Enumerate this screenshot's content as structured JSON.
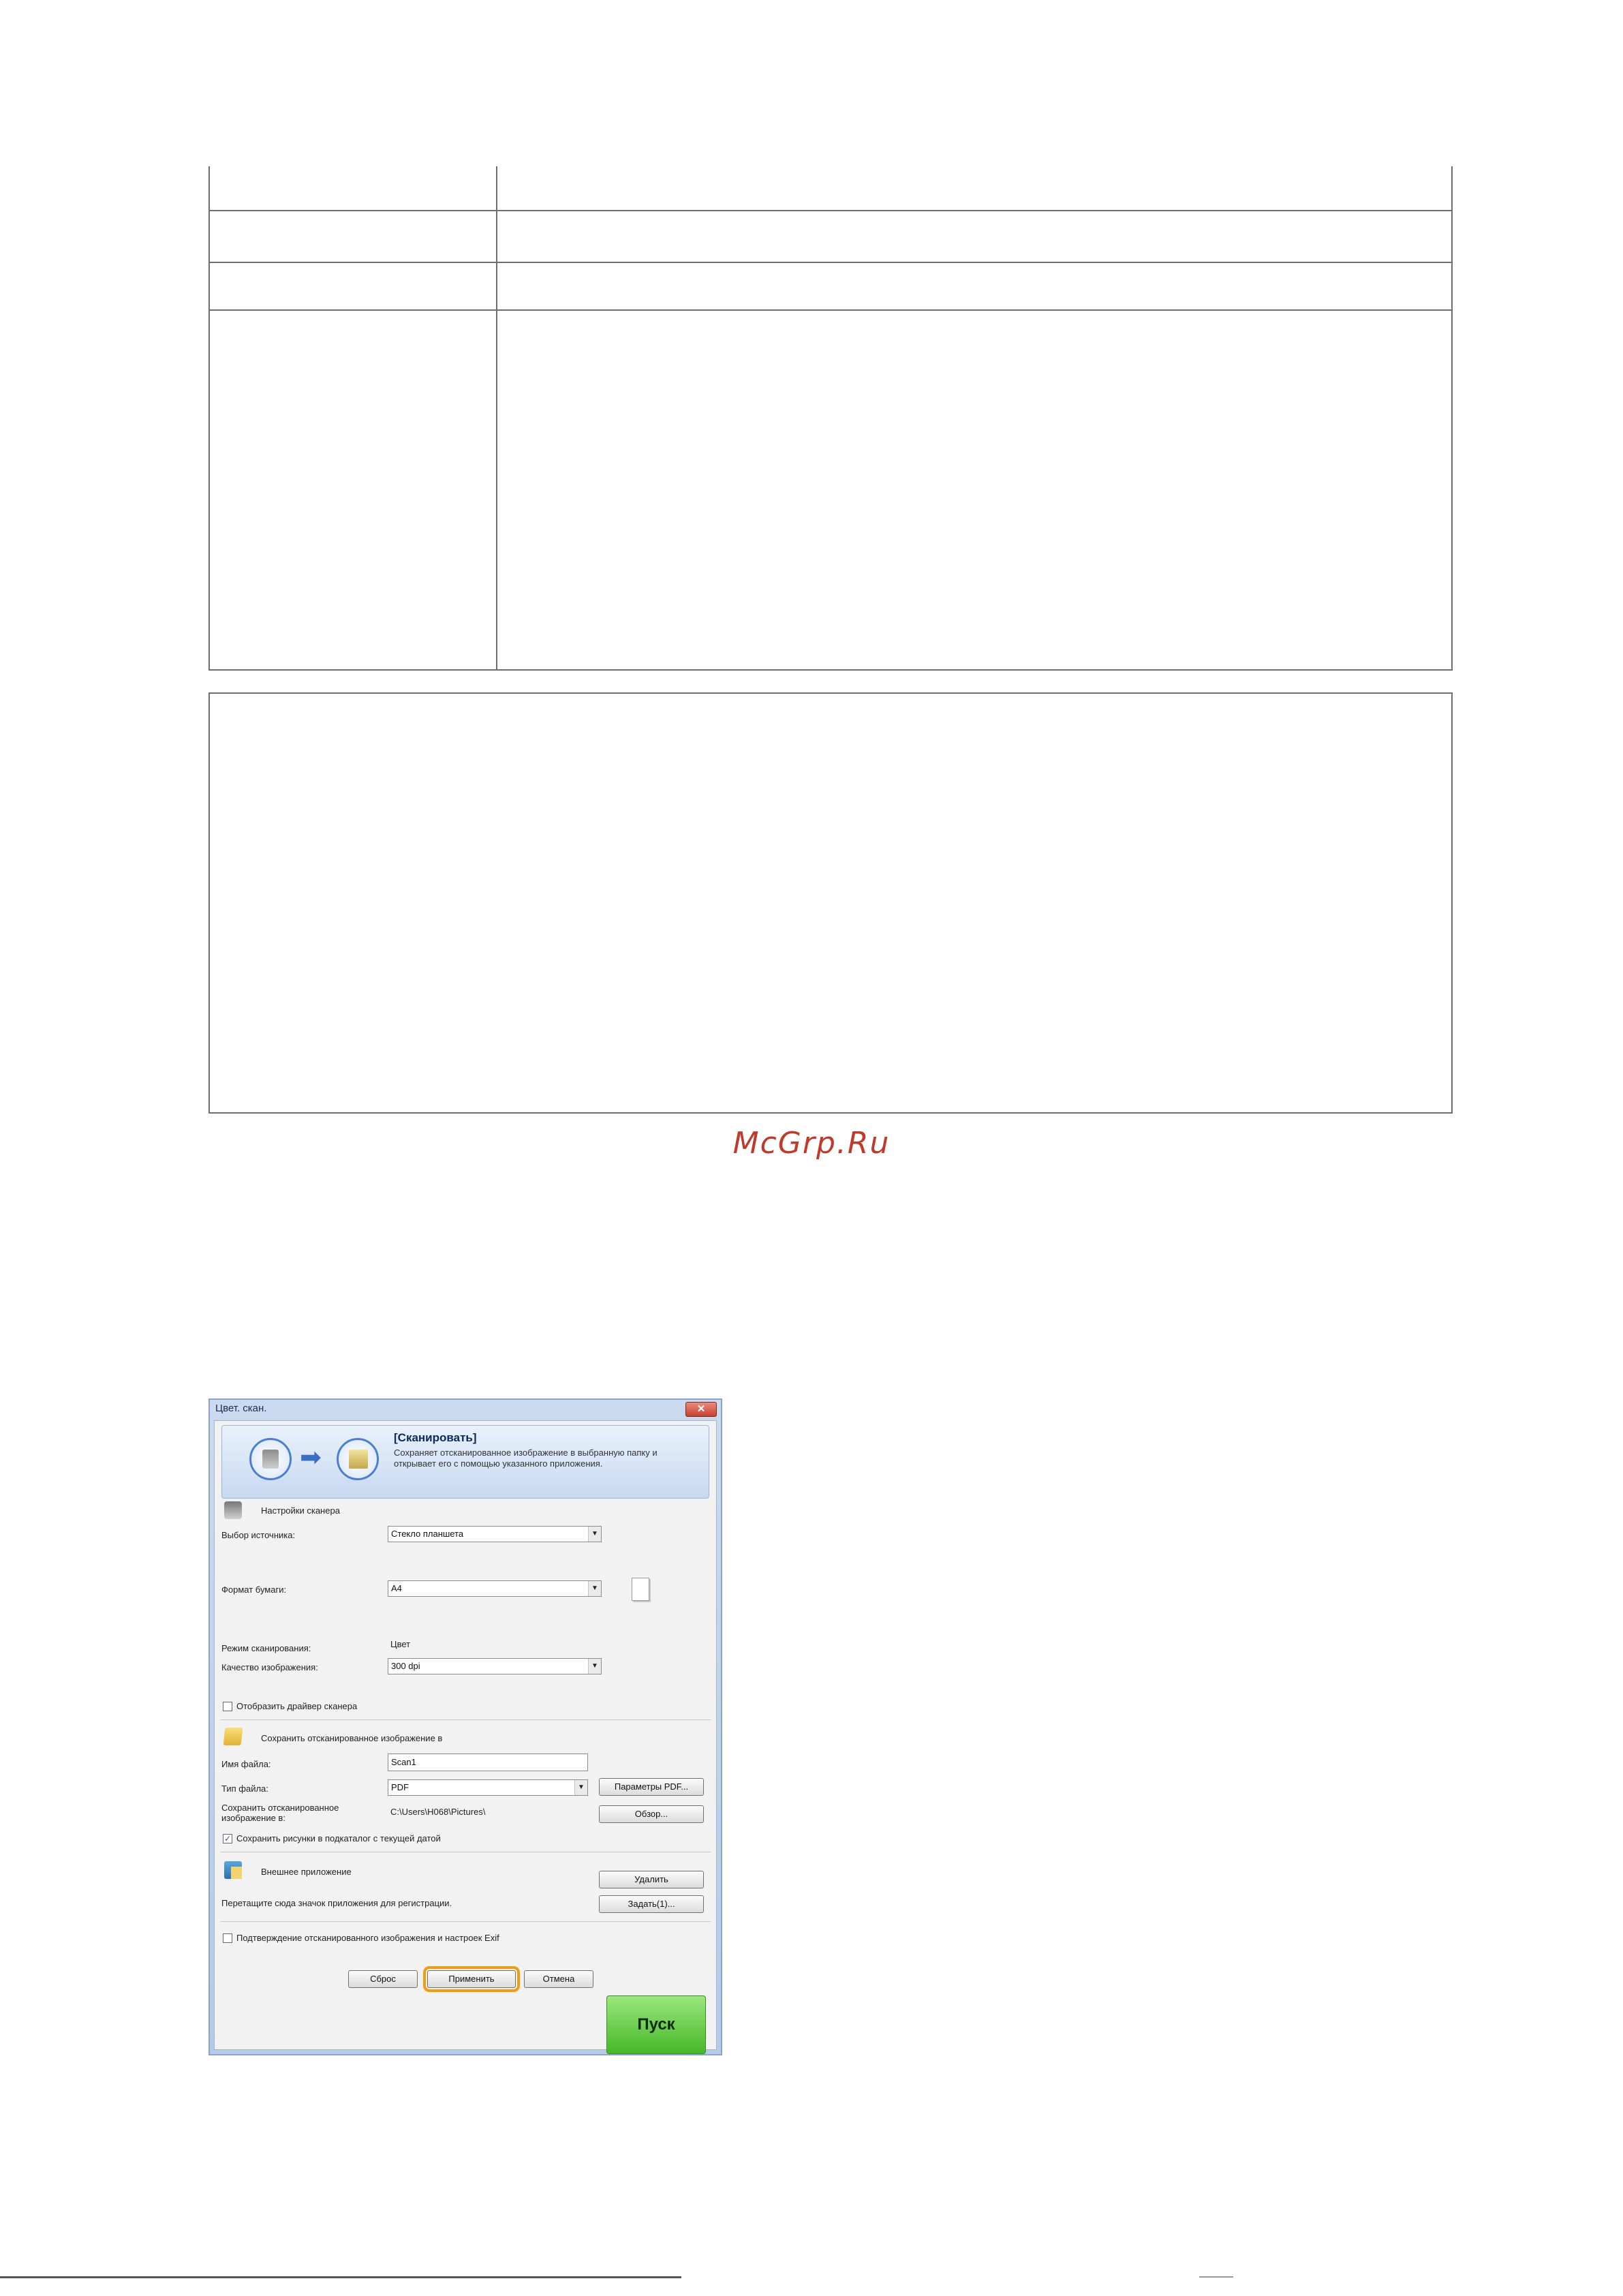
{
  "watermark": "McGrp.Ru",
  "dialog": {
    "title": "Цвет. скан.",
    "close_glyph": "✕",
    "banner": {
      "title": "[Сканировать]",
      "description": "Сохраняет отсканированное изображение в выбранную папку и открывает его с помощью указанного приложения."
    },
    "scanner_settings": {
      "heading": "Настройки сканера",
      "source_label": "Выбор источника:",
      "source_value": "Стекло планшета",
      "paper_label": "Формат бумаги:",
      "paper_value": "A4",
      "mode_label": "Режим сканирования:",
      "mode_value": "Цвет",
      "quality_label": "Качество изображения:",
      "quality_value": "300 dpi",
      "show_driver_label": "Отобразить драйвер сканера",
      "show_driver_checked": false
    },
    "save_settings": {
      "heading": "Сохранить отсканированное изображение в",
      "filename_label": "Имя файла:",
      "filename_value": "Scan1",
      "filetype_label": "Тип файла:",
      "filetype_value": "PDF",
      "pdf_params_button": "Параметры PDF...",
      "save_to_label": "Сохранить отсканированное изображение в:",
      "save_to_value": "C:\\Users\\H068\\Pictures\\",
      "browse_button": "Обзор...",
      "subfolder_label": "Сохранить рисунки в подкаталог с текущей датой",
      "subfolder_checked": true
    },
    "external_app": {
      "heading": "Внешнее приложение",
      "delete_button": "Удалить",
      "drag_hint": "Перетащите сюда значок приложения для регистрации.",
      "set_button": "Задать(1)..."
    },
    "confirm_label": "Подтверждение отсканированного изображения и настроек Exif",
    "confirm_checked": false,
    "reset_button": "Сброс",
    "apply_button": "Применить",
    "cancel_button": "Отмена",
    "start_button": "Пуск"
  }
}
